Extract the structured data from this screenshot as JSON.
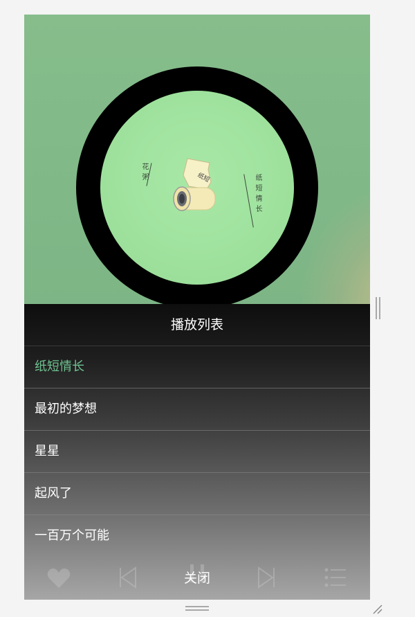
{
  "cover": {
    "artist_vertical": "花粥",
    "title_vertical": "纸短情长",
    "icon": "paper-scroll-icon"
  },
  "playlist": {
    "title": "播放列表",
    "songs": [
      {
        "label": "纸短情长",
        "active": true
      },
      {
        "label": "最初的梦想",
        "active": false
      },
      {
        "label": "星星",
        "active": false
      },
      {
        "label": "起风了",
        "active": false
      },
      {
        "label": "一百万个可能",
        "active": false
      }
    ],
    "close_label": "关闭"
  },
  "controls": {
    "icons": [
      "heart-icon",
      "previous-icon",
      "pause-icon",
      "next-icon",
      "playlist-icon"
    ]
  },
  "colors": {
    "background": "#7fb987",
    "disc_label": "#9ee19d",
    "active_song": "#6ec391"
  }
}
